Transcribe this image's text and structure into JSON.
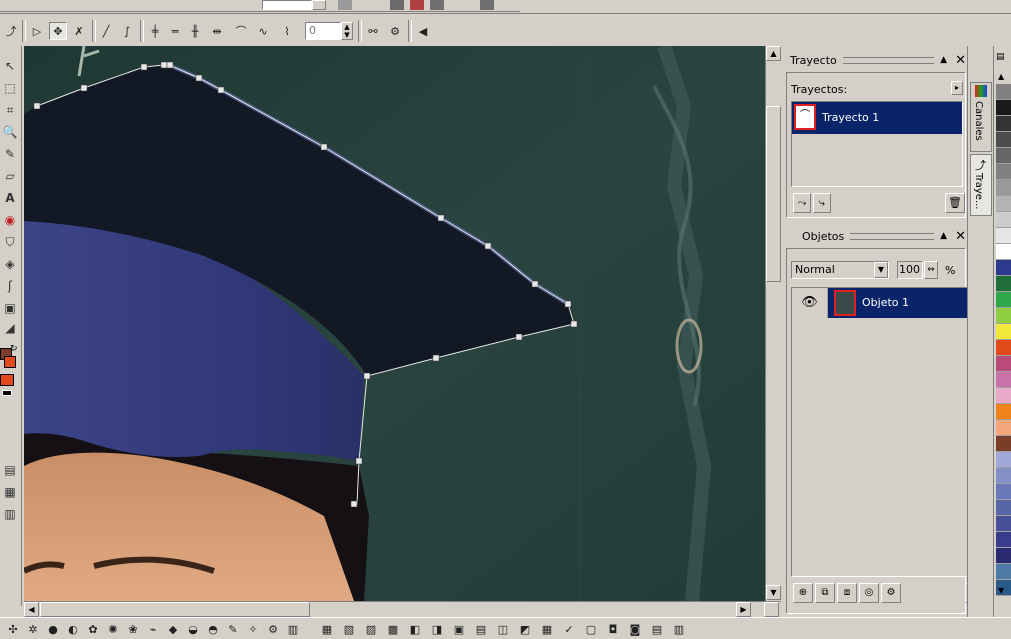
{
  "path_panel": {
    "title": "Trayecto",
    "list_label": "Trayectos:",
    "paths": [
      {
        "name": "Trayecto 1"
      }
    ]
  },
  "objects_panel": {
    "title": "Objetos",
    "blend_mode": "Normal",
    "opacity": "100",
    "percent": "%",
    "objects": [
      {
        "name": "Objeto 1"
      }
    ]
  },
  "side_tabs": {
    "channels": "Canales",
    "paths": "Traye..."
  },
  "toolbar": {
    "node_value": "0"
  },
  "icons": {
    "pick_tool": "arrow-icon",
    "eye": "eye-icon",
    "trash": "trash-icon"
  },
  "colors": {
    "selection_blue": "#0a246a",
    "workspace_gray": "#d4d0c8",
    "fg_color": "#e34a1b",
    "bg_color": "#7a3d2a",
    "palette": [
      "#808080",
      "#1a1a1a",
      "#333333",
      "#4d4d4d",
      "#666666",
      "#808080",
      "#999999",
      "#b3b3b3",
      "#cccccc",
      "#e6e6e6",
      "#ffffff",
      "#2b3a8c",
      "#1f6e3a",
      "#2fa84a",
      "#8fcf3f",
      "#f0e83a",
      "#e34a1b",
      "#b94a7a",
      "#c872a8",
      "#e8a8c8",
      "#f0821a",
      "#f4a67a",
      "#7a3d2a",
      "#a0a8d8",
      "#8490c8",
      "#6878b8",
      "#5866a8",
      "#48509a",
      "#383c8c",
      "#2a2a70",
      "#4e7aa8",
      "#2a5a8a"
    ]
  }
}
